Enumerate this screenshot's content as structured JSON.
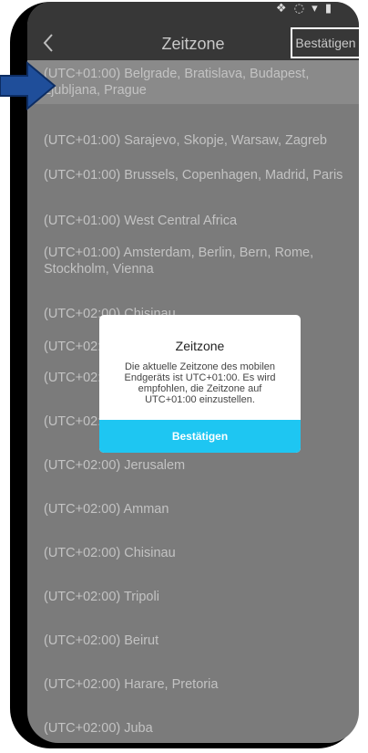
{
  "header": {
    "title": "Zeitzone",
    "confirm_label": "Bestätigen",
    "status_icons": "❖ ◌ ▾ ▮"
  },
  "timezones": [
    {
      "label": "(UTC+01:00) Belgrade, Bratislava, Budapest, Ljubljana, Prague",
      "selected": true
    },
    {
      "label": "(UTC+01:00) Sarajevo, Skopje, Warsaw, Zagreb"
    },
    {
      "label": "(UTC+01:00) Brussels, Copenhagen, Madrid, Paris"
    },
    {
      "label": "(UTC+01:00) West Central Africa"
    },
    {
      "label": "(UTC+01:00) Amsterdam, Berlin, Bern, Rome, Stockholm, Vienna"
    },
    {
      "label": "(UTC+02:00) Chisinau"
    },
    {
      "label": "(UTC+02:00)"
    },
    {
      "label": "(UTC+02:00)                                              nius"
    },
    {
      "label": "(UTC+02:00)"
    },
    {
      "label": "(UTC+02:00) Jerusalem"
    },
    {
      "label": "(UTC+02:00) Amman"
    },
    {
      "label": "(UTC+02:00) Chisinau"
    },
    {
      "label": "(UTC+02:00) Tripoli"
    },
    {
      "label": "(UTC+02:00) Beirut"
    },
    {
      "label": "(UTC+02:00) Harare, Pretoria"
    },
    {
      "label": "(UTC+02:00) Juba"
    }
  ],
  "dialog": {
    "title": "Zeitzone",
    "message": "Die aktuelle Zeitzone des mobilen Endgeräts ist UTC+01:00. Es wird empfohlen, die Zeitzone auf UTC+01:00 einzustellen.",
    "button_label": "Bestätigen"
  },
  "colors": {
    "header": "#373737",
    "overlay_bg": "#7b7b7b",
    "accent": "#1ec6f2",
    "arrow": "#1f4e9a"
  }
}
